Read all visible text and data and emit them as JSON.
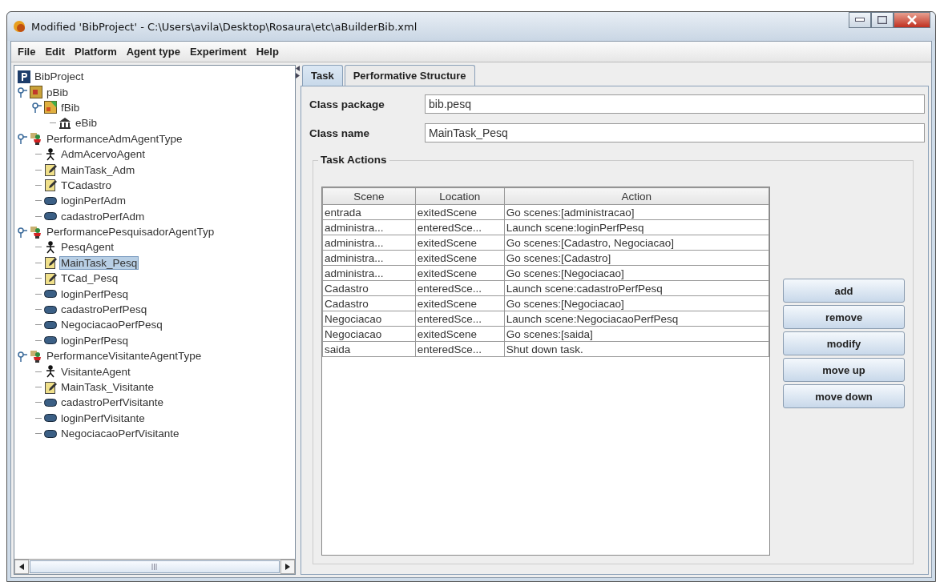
{
  "window": {
    "title": "Modified 'BibProject' - C:\\Users\\avila\\Desktop\\Rosaura\\etc\\aBuilderBib.xml"
  },
  "menu": [
    "File",
    "Edit",
    "Platform",
    "Agent type",
    "Experiment",
    "Help"
  ],
  "tree": [
    {
      "label": "BibProject",
      "kind": "project",
      "selected": false,
      "children": [
        {
          "label": "pBib",
          "kind": "platform",
          "selected": false,
          "expanded": true,
          "children": [
            {
              "label": "fBib",
              "kind": "federation",
              "selected": false,
              "expanded": true,
              "children": [
                {
                  "label": "eBib",
                  "kind": "environment",
                  "selected": false
                }
              ]
            }
          ]
        },
        {
          "label": "PerformanceAdmAgentType",
          "kind": "agenttype",
          "selected": false,
          "expanded": true,
          "children": [
            {
              "label": "AdmAcervoAgent",
              "kind": "agent",
              "selected": false
            },
            {
              "label": "MainTask_Adm",
              "kind": "task",
              "selected": false
            },
            {
              "label": "TCadastro",
              "kind": "task",
              "selected": false
            },
            {
              "label": "loginPerfAdm",
              "kind": "scene",
              "selected": false
            },
            {
              "label": "cadastroPerfAdm",
              "kind": "scene",
              "selected": false
            }
          ]
        },
        {
          "label": "PerformancePesquisadorAgentTyp",
          "kind": "agenttype",
          "selected": false,
          "expanded": true,
          "children": [
            {
              "label": "PesqAgent",
              "kind": "agent",
              "selected": false
            },
            {
              "label": "MainTask_Pesq",
              "kind": "task",
              "selected": true
            },
            {
              "label": "TCad_Pesq",
              "kind": "task",
              "selected": false
            },
            {
              "label": "loginPerfPesq",
              "kind": "scene",
              "selected": false
            },
            {
              "label": "cadastroPerfPesq",
              "kind": "scene",
              "selected": false
            },
            {
              "label": "NegociacaoPerfPesq",
              "kind": "scene",
              "selected": false
            },
            {
              "label": "loginPerfPesq",
              "kind": "scene",
              "selected": false
            }
          ]
        },
        {
          "label": "PerformanceVisitanteAgentType",
          "kind": "agenttype",
          "selected": false,
          "expanded": true,
          "children": [
            {
              "label": "VisitanteAgent",
              "kind": "agent",
              "selected": false
            },
            {
              "label": "MainTask_Visitante",
              "kind": "task",
              "selected": false
            },
            {
              "label": "cadastroPerfVisitante",
              "kind": "scene",
              "selected": false
            },
            {
              "label": "loginPerfVisitante",
              "kind": "scene",
              "selected": false
            },
            {
              "label": "NegociacaoPerfVisitante",
              "kind": "scene",
              "selected": false
            }
          ]
        }
      ]
    }
  ],
  "tabs": [
    {
      "label": "Task",
      "selected": true
    },
    {
      "label": "Performative Structure",
      "selected": false
    }
  ],
  "fields": [
    {
      "label": "Class package",
      "value": "bib.pesq"
    },
    {
      "label": "Class name",
      "value": "MainTask_Pesq"
    }
  ],
  "task_actions": {
    "title": "Task Actions",
    "columns": [
      "Scene",
      "Location",
      "Action"
    ],
    "rows": [
      [
        "entrada",
        "exitedScene",
        "Go scenes:[administracao]"
      ],
      [
        "administra...",
        "enteredSce...",
        "Launch scene:loginPerfPesq"
      ],
      [
        "administra...",
        "exitedScene",
        "Go scenes:[Cadastro, Negociacao]"
      ],
      [
        "administra...",
        "exitedScene",
        "Go scenes:[Cadastro]"
      ],
      [
        "administra...",
        "exitedScene",
        "Go scenes:[Negociacao]"
      ],
      [
        "Cadastro",
        "enteredSce...",
        "Launch scene:cadastroPerfPesq"
      ],
      [
        "Cadastro",
        "exitedScene",
        "Go scenes:[Negociacao]"
      ],
      [
        "Negociacao",
        "enteredSce...",
        "Launch scene:NegociacaoPerfPesq"
      ],
      [
        "Negociacao",
        "exitedScene",
        "Go scenes:[saida]"
      ],
      [
        "saida",
        "enteredSce...",
        "Shut down task."
      ]
    ],
    "buttons": [
      "add",
      "remove",
      "modify",
      "move up",
      "move down"
    ]
  }
}
